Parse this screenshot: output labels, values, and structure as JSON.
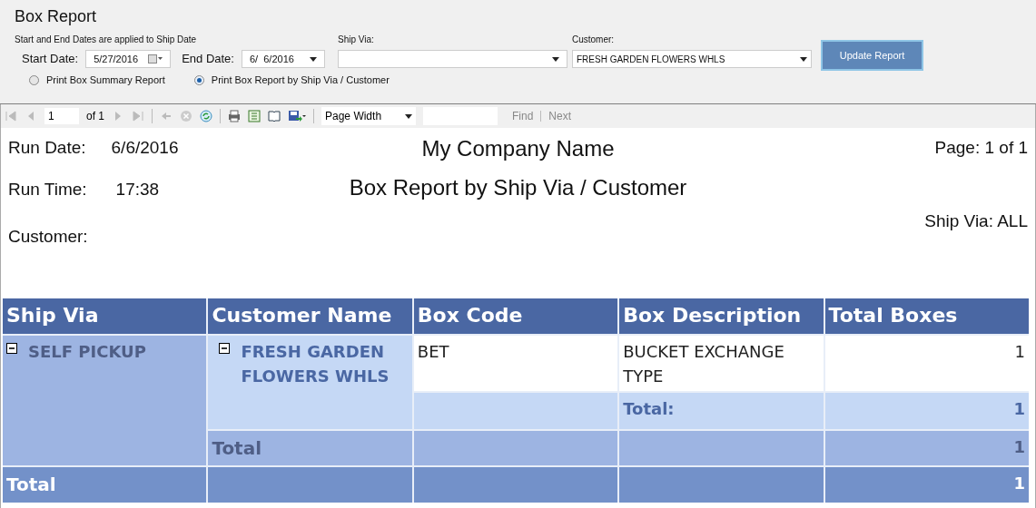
{
  "form": {
    "title": "Box Report",
    "note": "Start and End Dates are applied to Ship Date",
    "start_date": {
      "label": "Start Date:",
      "value": "5/27/2016"
    },
    "end_date": {
      "label": "End Date:",
      "value": "6/  6/2016"
    },
    "ship_via": {
      "label": "Ship Via:"
    },
    "customer": {
      "label": "Customer:",
      "value": "FRESH GARDEN FLOWERS WHLS"
    },
    "update_button": "Update Report",
    "radios": [
      {
        "label": "Print Box Summary Report",
        "selected": false
      },
      {
        "label": "Print Box Report by Ship Via / Customer",
        "selected": true
      }
    ]
  },
  "toolbar": {
    "page": "1",
    "of": "of 1",
    "zoom": "Page Width",
    "find": "Find",
    "next": "Next"
  },
  "report": {
    "run_date_label": "Run Date:",
    "run_date": "6/6/2016",
    "company": "My Company Name",
    "page": "Page: 1 of 1",
    "run_time_label": "Run Time:",
    "run_time": "17:38",
    "title": "Box Report by Ship Via / Customer",
    "ship_via": "Ship Via: ALL",
    "customer_label": "Customer:"
  },
  "table": {
    "columns": [
      "Ship Via",
      "Customer Name",
      "Box Code",
      "Box Description",
      "Total Boxes"
    ],
    "group": {
      "name": "SELF PICKUP",
      "expanded": true,
      "customer": {
        "name": "FRESH GARDEN FLOWERS WHLS",
        "expanded": true,
        "items": [
          {
            "code": "BET",
            "description": "BUCKET EXCHANGE TYPE",
            "total": "1"
          }
        ],
        "subtotal_label": "Total:",
        "subtotal": "1"
      },
      "total_label": "Total",
      "total": "1"
    },
    "grand_total_label": "Total",
    "grand_total": "1"
  }
}
